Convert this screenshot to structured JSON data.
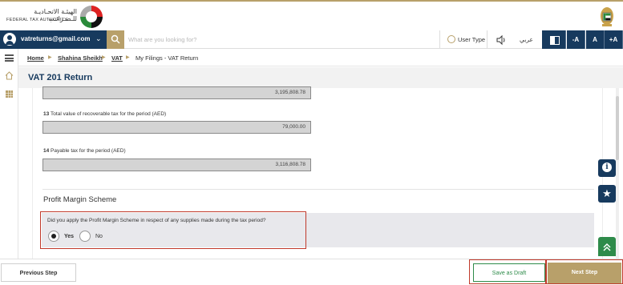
{
  "header": {
    "logo_ar": "الهيئـة الاتحـاديـة للـضـرائـب",
    "logo_en": "FEDERAL TAX AUTHORITY",
    "emblem_icon": "uae-emblem-icon"
  },
  "toolbar": {
    "email": "vatreturns@gmail.com",
    "search_placeholder": "What are you looking for?",
    "user_type_label": "User Type",
    "language_label": "عربي",
    "font_decrease": "-A",
    "font_default": "A",
    "font_increase": "+A"
  },
  "breadcrumb": {
    "items": [
      "Home",
      "Shahina Sheikh",
      "VAT"
    ],
    "current": "My Filings - VAT Return"
  },
  "page": {
    "title": "VAT 201 Return"
  },
  "form": {
    "top_field_value": "3,195,808.78",
    "field13": {
      "number": "13",
      "label": "Total value of recoverable tax for the period (AED)",
      "value": "79,000.00"
    },
    "field14": {
      "number": "14",
      "label": "Payable tax for the period (AED)",
      "value": "3,116,808.78"
    },
    "section_title": "Profit Margin Scheme",
    "question": "Did you apply the Profit Margin Scheme in respect of any supplies made during the tax period?",
    "options": [
      {
        "label": "Yes",
        "selected": true
      },
      {
        "label": "No",
        "selected": false
      }
    ]
  },
  "footer": {
    "previous": "Previous Step",
    "save_draft": "Save as Draft",
    "next": "Next Step"
  },
  "colors": {
    "navy": "#173a5e",
    "gold": "#b8a06a",
    "green": "#2e8b4a",
    "highlight_red": "#c0392b"
  }
}
